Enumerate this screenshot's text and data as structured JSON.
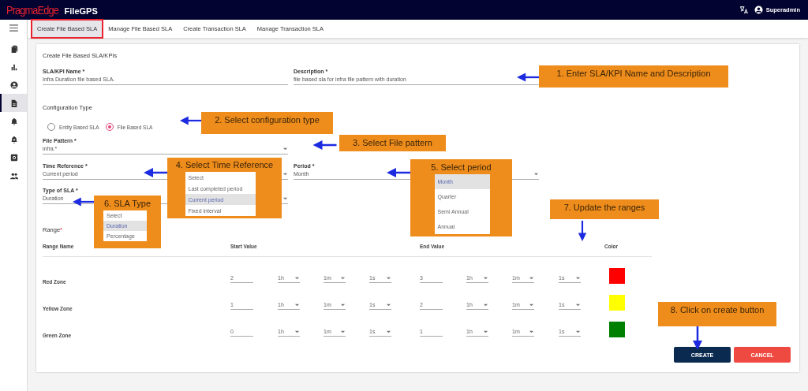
{
  "header": {
    "logo_brand": "PragmaEdge",
    "logo_product": "FileGPS",
    "user": "Superadmin"
  },
  "sidebar": {
    "items": [
      {
        "selected": false
      },
      {
        "selected": false
      },
      {
        "selected": false
      },
      {
        "selected": true
      },
      {
        "selected": false
      },
      {
        "selected": false
      },
      {
        "selected": false
      },
      {
        "selected": false
      }
    ]
  },
  "tabs": [
    {
      "label": "Create File Based SLA",
      "selected": true,
      "annotated": true
    },
    {
      "label": "Manage File Based SLA",
      "selected": false,
      "annotated": false
    },
    {
      "label": "Create Transaction SLA",
      "selected": false,
      "annotated": false
    },
    {
      "label": "Manage Transaction SLA",
      "selected": false,
      "annotated": false
    }
  ],
  "form": {
    "title": "Create File Based SLA/KPIs",
    "name_field": {
      "label": "SLA/KPI Name *",
      "value": "Infra Duration file based SLA."
    },
    "description_field": {
      "label": "Description *",
      "value": "file based sla for infra file pattern with duration"
    },
    "configuration_type": {
      "label": "Configuration Type",
      "options": [
        {
          "label": "Entity Based SLA",
          "selected": false
        },
        {
          "label": "File Based SLA",
          "selected": true
        }
      ]
    },
    "file_pattern": {
      "label": "File Pattern *",
      "value": "infra.*"
    },
    "time_reference": {
      "label": "Time Reference *",
      "value": "Current period"
    },
    "period": {
      "label": "Period *",
      "value": "Month"
    },
    "sla_type": {
      "label": "Type of SLA *",
      "value": "Duration"
    },
    "range": {
      "label": "Range",
      "required_mark": "*",
      "columns": [
        "Range Name",
        "Start Value",
        "End Value",
        "Color"
      ],
      "rows": [
        {
          "name": "Red Zone",
          "start": {
            "value": "2",
            "hours": "1h",
            "minutes": "1m",
            "seconds": "1s"
          },
          "end": {
            "value": "3",
            "hours": "1h",
            "minutes": "1m",
            "seconds": "1s"
          },
          "color": "#ff0000"
        },
        {
          "name": "Yellow Zone",
          "start": {
            "value": "1",
            "hours": "1h",
            "minutes": "1m",
            "seconds": "1s"
          },
          "end": {
            "value": "2",
            "hours": "1h",
            "minutes": "1m",
            "seconds": "1s"
          },
          "color": "#ffff00"
        },
        {
          "name": "Green Zone",
          "start": {
            "value": "0",
            "hours": "1h",
            "minutes": "1m",
            "seconds": "1s"
          },
          "end": {
            "value": "1",
            "hours": "1h",
            "minutes": "1m",
            "seconds": "1s"
          },
          "color": "#008000"
        }
      ]
    },
    "buttons": [
      {
        "label": "CREATE",
        "kind": "primary"
      },
      {
        "label": "CANCEL",
        "kind": "danger"
      }
    ]
  },
  "callouts": [
    {
      "text": "1. Enter SLA/KPI Name and Description",
      "kind": "arrow-left"
    },
    {
      "text": "2. Select configuration type",
      "kind": "arrow-left"
    },
    {
      "text": "3. Select File pattern",
      "kind": "arrow-left"
    },
    {
      "text": "4. Select Time Reference",
      "kind": "arrow-left",
      "options": [
        {
          "label": "Select",
          "selected": false
        },
        {
          "label": "Last completed period",
          "selected": false
        },
        {
          "label": "Current period",
          "selected": true
        },
        {
          "label": "Fixed interval",
          "selected": false
        }
      ]
    },
    {
      "text": "5. Select period",
      "kind": "arrow-left",
      "options": [
        {
          "label": "Month",
          "selected": true
        },
        {
          "label": "Quarter",
          "selected": false
        },
        {
          "label": "Semi Annual",
          "selected": false
        },
        {
          "label": "Annual",
          "selected": false
        }
      ]
    },
    {
      "text": "6. SLA Type",
      "kind": "arrow-left",
      "options": [
        {
          "label": "Select",
          "selected": false
        },
        {
          "label": "Duration",
          "selected": true
        },
        {
          "label": "Percentage",
          "selected": false
        }
      ]
    },
    {
      "text": "7. Update the ranges",
      "kind": "arrow-down"
    },
    {
      "text": "8. Click on create button",
      "kind": "arrow-down"
    }
  ]
}
